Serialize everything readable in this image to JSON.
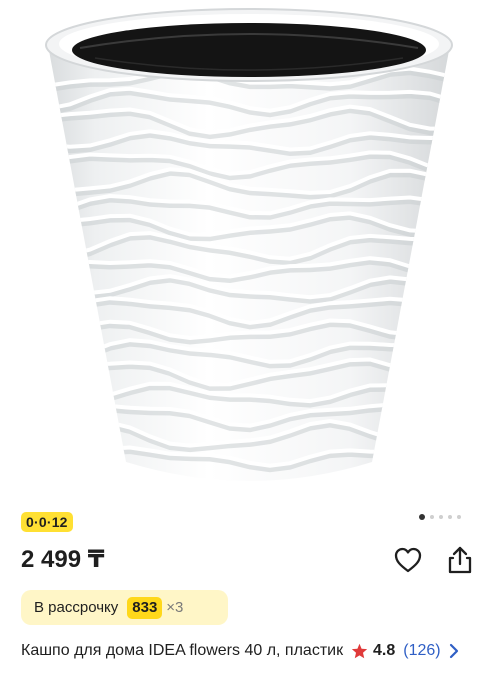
{
  "product": {
    "image_icon": "white-wavy-flower-pot-image",
    "carousel_dot_count": 5,
    "carousel_active_index": 0,
    "installment_badge": "0·0·12",
    "price": "2 499 ₸",
    "favorite_icon": "heart-icon",
    "share_icon": "share-icon",
    "credit": {
      "label": "В рассрочку",
      "amount": "833",
      "times": "×3"
    },
    "title": "Кашпо для дома IDEA flowers 40 л, пластик",
    "rating": {
      "star_icon": "star-icon",
      "score": "4.8",
      "count": "(126)",
      "chevron_icon": "chevron-right-icon"
    }
  },
  "colors": {
    "badge_yellow": "#ffe033",
    "credit_bg": "#fff6c7",
    "credit_amount_bg": "#ffd81a",
    "star_red": "#e03a3a",
    "link_blue": "#2f5fc5",
    "text": "#1f1f1f"
  }
}
